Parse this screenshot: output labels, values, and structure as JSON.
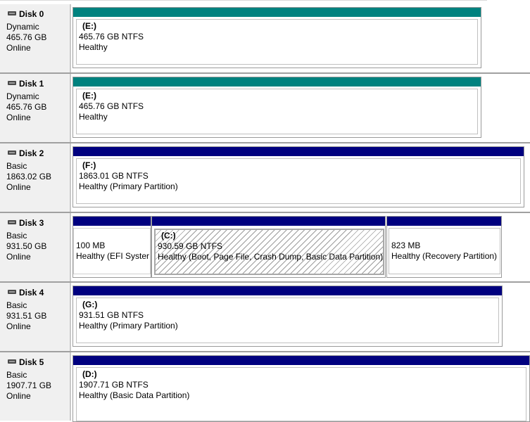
{
  "colors": {
    "dynamic_bar": "#00827f",
    "basic_bar": "#00007f"
  },
  "disks": [
    {
      "name": "Disk 0",
      "type": "Dynamic",
      "size": "465.76 GB",
      "status": "Online",
      "volumes": [
        {
          "letter": "(E:)",
          "size_fs": "465.76 GB NTFS",
          "health": "Healthy",
          "bar": "teal"
        }
      ]
    },
    {
      "name": "Disk 1",
      "type": "Dynamic",
      "size": "465.76 GB",
      "status": "Online",
      "volumes": [
        {
          "letter": "(E:)",
          "size_fs": "465.76 GB NTFS",
          "health": "Healthy",
          "bar": "teal"
        }
      ]
    },
    {
      "name": "Disk 2",
      "type": "Basic",
      "size": "1863.02 GB",
      "status": "Online",
      "volumes": [
        {
          "letter": "(F:)",
          "size_fs": "1863.01 GB NTFS",
          "health": "Healthy (Primary Partition)",
          "bar": "navy"
        }
      ]
    },
    {
      "name": "Disk 3",
      "type": "Basic",
      "size": "931.50 GB",
      "status": "Online",
      "volumes": [
        {
          "letter": "",
          "size_fs": "100 MB",
          "health": "Healthy (EFI Syster",
          "bar": "navy"
        },
        {
          "letter": "(C:)",
          "size_fs": "930.59 GB NTFS",
          "health": "Healthy (Boot, Page File, Crash Dump, Basic Data Partition)",
          "bar": "navy",
          "selected": true
        },
        {
          "letter": "",
          "size_fs": "823 MB",
          "health": "Healthy (Recovery Partition)",
          "bar": "navy"
        }
      ]
    },
    {
      "name": "Disk 4",
      "type": "Basic",
      "size": "931.51 GB",
      "status": "Online",
      "volumes": [
        {
          "letter": "(G:)",
          "size_fs": "931.51 GB NTFS",
          "health": "Healthy (Primary Partition)",
          "bar": "navy"
        }
      ]
    },
    {
      "name": "Disk 5",
      "type": "Basic",
      "size": "1907.71 GB",
      "status": "Online",
      "volumes": [
        {
          "letter": "(D:)",
          "size_fs": "1907.71 GB NTFS",
          "health": "Healthy (Basic Data Partition)",
          "bar": "navy"
        }
      ]
    }
  ]
}
